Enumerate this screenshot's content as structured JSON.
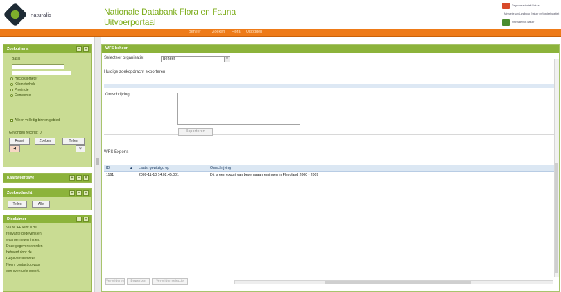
{
  "header": {
    "logo_text": "naturalis",
    "title_line1": "Nationale Databank Flora en Fauna",
    "title_line2": "Uitvoerportaal",
    "partners": [
      {
        "name": "Gegevensautoriteit Natuur",
        "color": "#d84a2a"
      },
      {
        "name": "Ministerie van Landbouw, Natuur en Voedselkwaliteit",
        "color": "#2a65a8"
      },
      {
        "name": "Informatiehuis Natuur",
        "color": "#4a8c2e"
      }
    ]
  },
  "menu": {
    "items": [
      "Beheer",
      "Zoeken",
      "Flora",
      "Uitloggen"
    ]
  },
  "sidebar": {
    "filter_panel": {
      "title": "Zoekcriteria",
      "label_basis": "Basis",
      "date_value": "",
      "radios": [
        "Hectokilometer",
        "Kilometerhok",
        "Provincie",
        "Gemeente"
      ],
      "checkbox_label": "Alleen volledig binnen gebied",
      "records_label": "Gevonden records: 0",
      "buttons": [
        "Reset",
        "Zoeken",
        "Tellen"
      ]
    },
    "panel2_title": "Kaartweergave",
    "panel3": {
      "title": "Zoekopdracht",
      "buttons": [
        "Tellen",
        "Alle"
      ]
    },
    "panel4": {
      "title": "Disclaimer",
      "lines": [
        "Via NDFF kunt u de",
        "relevante gegevens en",
        "waarnemingen inzien.",
        "Deze gegevens worden",
        "beheerd door de",
        "Gegevensautoriteit.",
        "Neem contact op voor",
        "een eventuele export."
      ]
    }
  },
  "main": {
    "title": "WFS beheer",
    "org_label": "Selecteer organisatie:",
    "org_value": "Beheer",
    "section_title": "Huidige zoekopdracht exporteren",
    "desc_label": "Omschrijving",
    "submit_label": "Exporteren",
    "exports_label": "WFS Exports",
    "grid": {
      "columns": [
        "ID",
        "Laatst gewijzigd op",
        "Omschrijving"
      ],
      "rows": [
        [
          "1161",
          "2009-11-10 14:02:45.001",
          "Dit is een export van bevernaaarnemingen in Flevoland 2000 - 2009"
        ]
      ]
    },
    "bottom_buttons": [
      "Verwijderen",
      "Bewerken",
      "Verwijder selectie"
    ]
  }
}
